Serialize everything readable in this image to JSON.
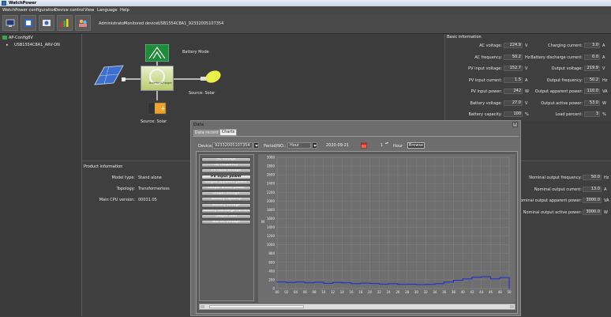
{
  "app": {
    "title": "WatchPower"
  },
  "menu": [
    "WatchPower configuration",
    "Device control",
    "View",
    "Language",
    "Help"
  ],
  "toolbar": {
    "user": "Administrator",
    "monitored_label": "Monitored device:",
    "monitored_device": "USB1554C8A1_92332005107354"
  },
  "tree": {
    "root": "AP-Config8V",
    "child": "USB1554C8A1_ARV-DN"
  },
  "diagram": {
    "mode": "Battery Mode",
    "source_left": "Source:  Solar",
    "source_right": "Source:  Solar",
    "inverter_label": "Inverter/Charger"
  },
  "basic": {
    "title": "Basic information",
    "left": [
      {
        "label": "AC voltage:",
        "value": "224.9",
        "unit": "V"
      },
      {
        "label": "AC frequency:",
        "value": "50.2",
        "unit": "Hz"
      },
      {
        "label": "PV input voltage:",
        "value": "152.7",
        "unit": "V"
      },
      {
        "label": "PV input current:",
        "value": "1.5",
        "unit": "A"
      },
      {
        "label": "PV input power:",
        "value": "242",
        "unit": "W"
      },
      {
        "label": "Battery voltage:",
        "value": "27.0",
        "unit": "V"
      },
      {
        "label": "Battery capacity:",
        "value": "100",
        "unit": "%"
      }
    ],
    "right": [
      {
        "label": "Charging current:",
        "value": "3.0",
        "unit": "A"
      },
      {
        "label": "Battery discharge current:",
        "value": "0.0",
        "unit": "A"
      },
      {
        "label": "Output voltage:",
        "value": "219.9",
        "unit": "V"
      },
      {
        "label": "Output frequency:",
        "value": "50.2",
        "unit": "Hz"
      },
      {
        "label": "Output apparent power:",
        "value": "110.0",
        "unit": "VA"
      },
      {
        "label": "Output active power:",
        "value": "53.0",
        "unit": "W"
      },
      {
        "label": "Load percent:",
        "value": "3",
        "unit": "%"
      }
    ]
  },
  "product": {
    "title": "Product information",
    "rows": [
      {
        "label": "Model type:",
        "value": "Stand alone"
      },
      {
        "label": "Topology:",
        "value": "Transformerless"
      },
      {
        "label": "Main CPU version:",
        "value": "00031.05"
      }
    ]
  },
  "rated": [
    {
      "label": "Nominal output frequency:",
      "value": "50.0",
      "unit": "Hz"
    },
    {
      "label": "Nominal output current:",
      "value": "13.0",
      "unit": "A"
    },
    {
      "label": "Nominal output apparent power:",
      "value": "3000.0",
      "unit": "VA"
    },
    {
      "label": "Nominal output active power:",
      "value": "3000.0",
      "unit": "W"
    }
  ],
  "dialog": {
    "title": "Data",
    "tabs": [
      "Data record",
      "Charts"
    ],
    "device_label": "Device:",
    "device_value": "92332005107354",
    "period_label": "Period/NO.:",
    "period_value": "Hour",
    "date_value": "2020-09-21",
    "count_value": "1",
    "count_unit": "Hour",
    "browse": "Browse",
    "series": [
      "AC voltage",
      "AC frequency",
      "PV input voltage",
      "PV input power",
      "Output apparent power",
      "Output active power",
      "Output voltage",
      "Battery capacity",
      "Battery voltage",
      "Battery discharge current",
      "Output load",
      "Bus DC voltage"
    ],
    "selected_series": "PV input power"
  },
  "chart_data": {
    "type": "line",
    "ylabel": "W",
    "ylim": [
      0,
      3000
    ],
    "yticks": [
      0,
      200,
      400,
      600,
      800,
      1000,
      1200,
      1400,
      1600,
      1800,
      2000,
      2200,
      2400,
      2600,
      2800,
      3000
    ],
    "x": [
      "00",
      "02",
      "04",
      "06",
      "08",
      "10",
      "12",
      "14",
      "16",
      "18",
      "20",
      "22",
      "24",
      "26",
      "28",
      "30",
      "32",
      "34",
      "36",
      "38",
      "40",
      "42",
      "44",
      "46",
      "48",
      "50"
    ],
    "series": [
      {
        "values": [
          150,
          140,
          150,
          130,
          145,
          120,
          140,
          130,
          110,
          125,
          115,
          100,
          110,
          95,
          100,
          90,
          95,
          110,
          150,
          190,
          220,
          260,
          270,
          220,
          250,
          240
        ],
        "color": "#1a2ad8"
      }
    ]
  }
}
